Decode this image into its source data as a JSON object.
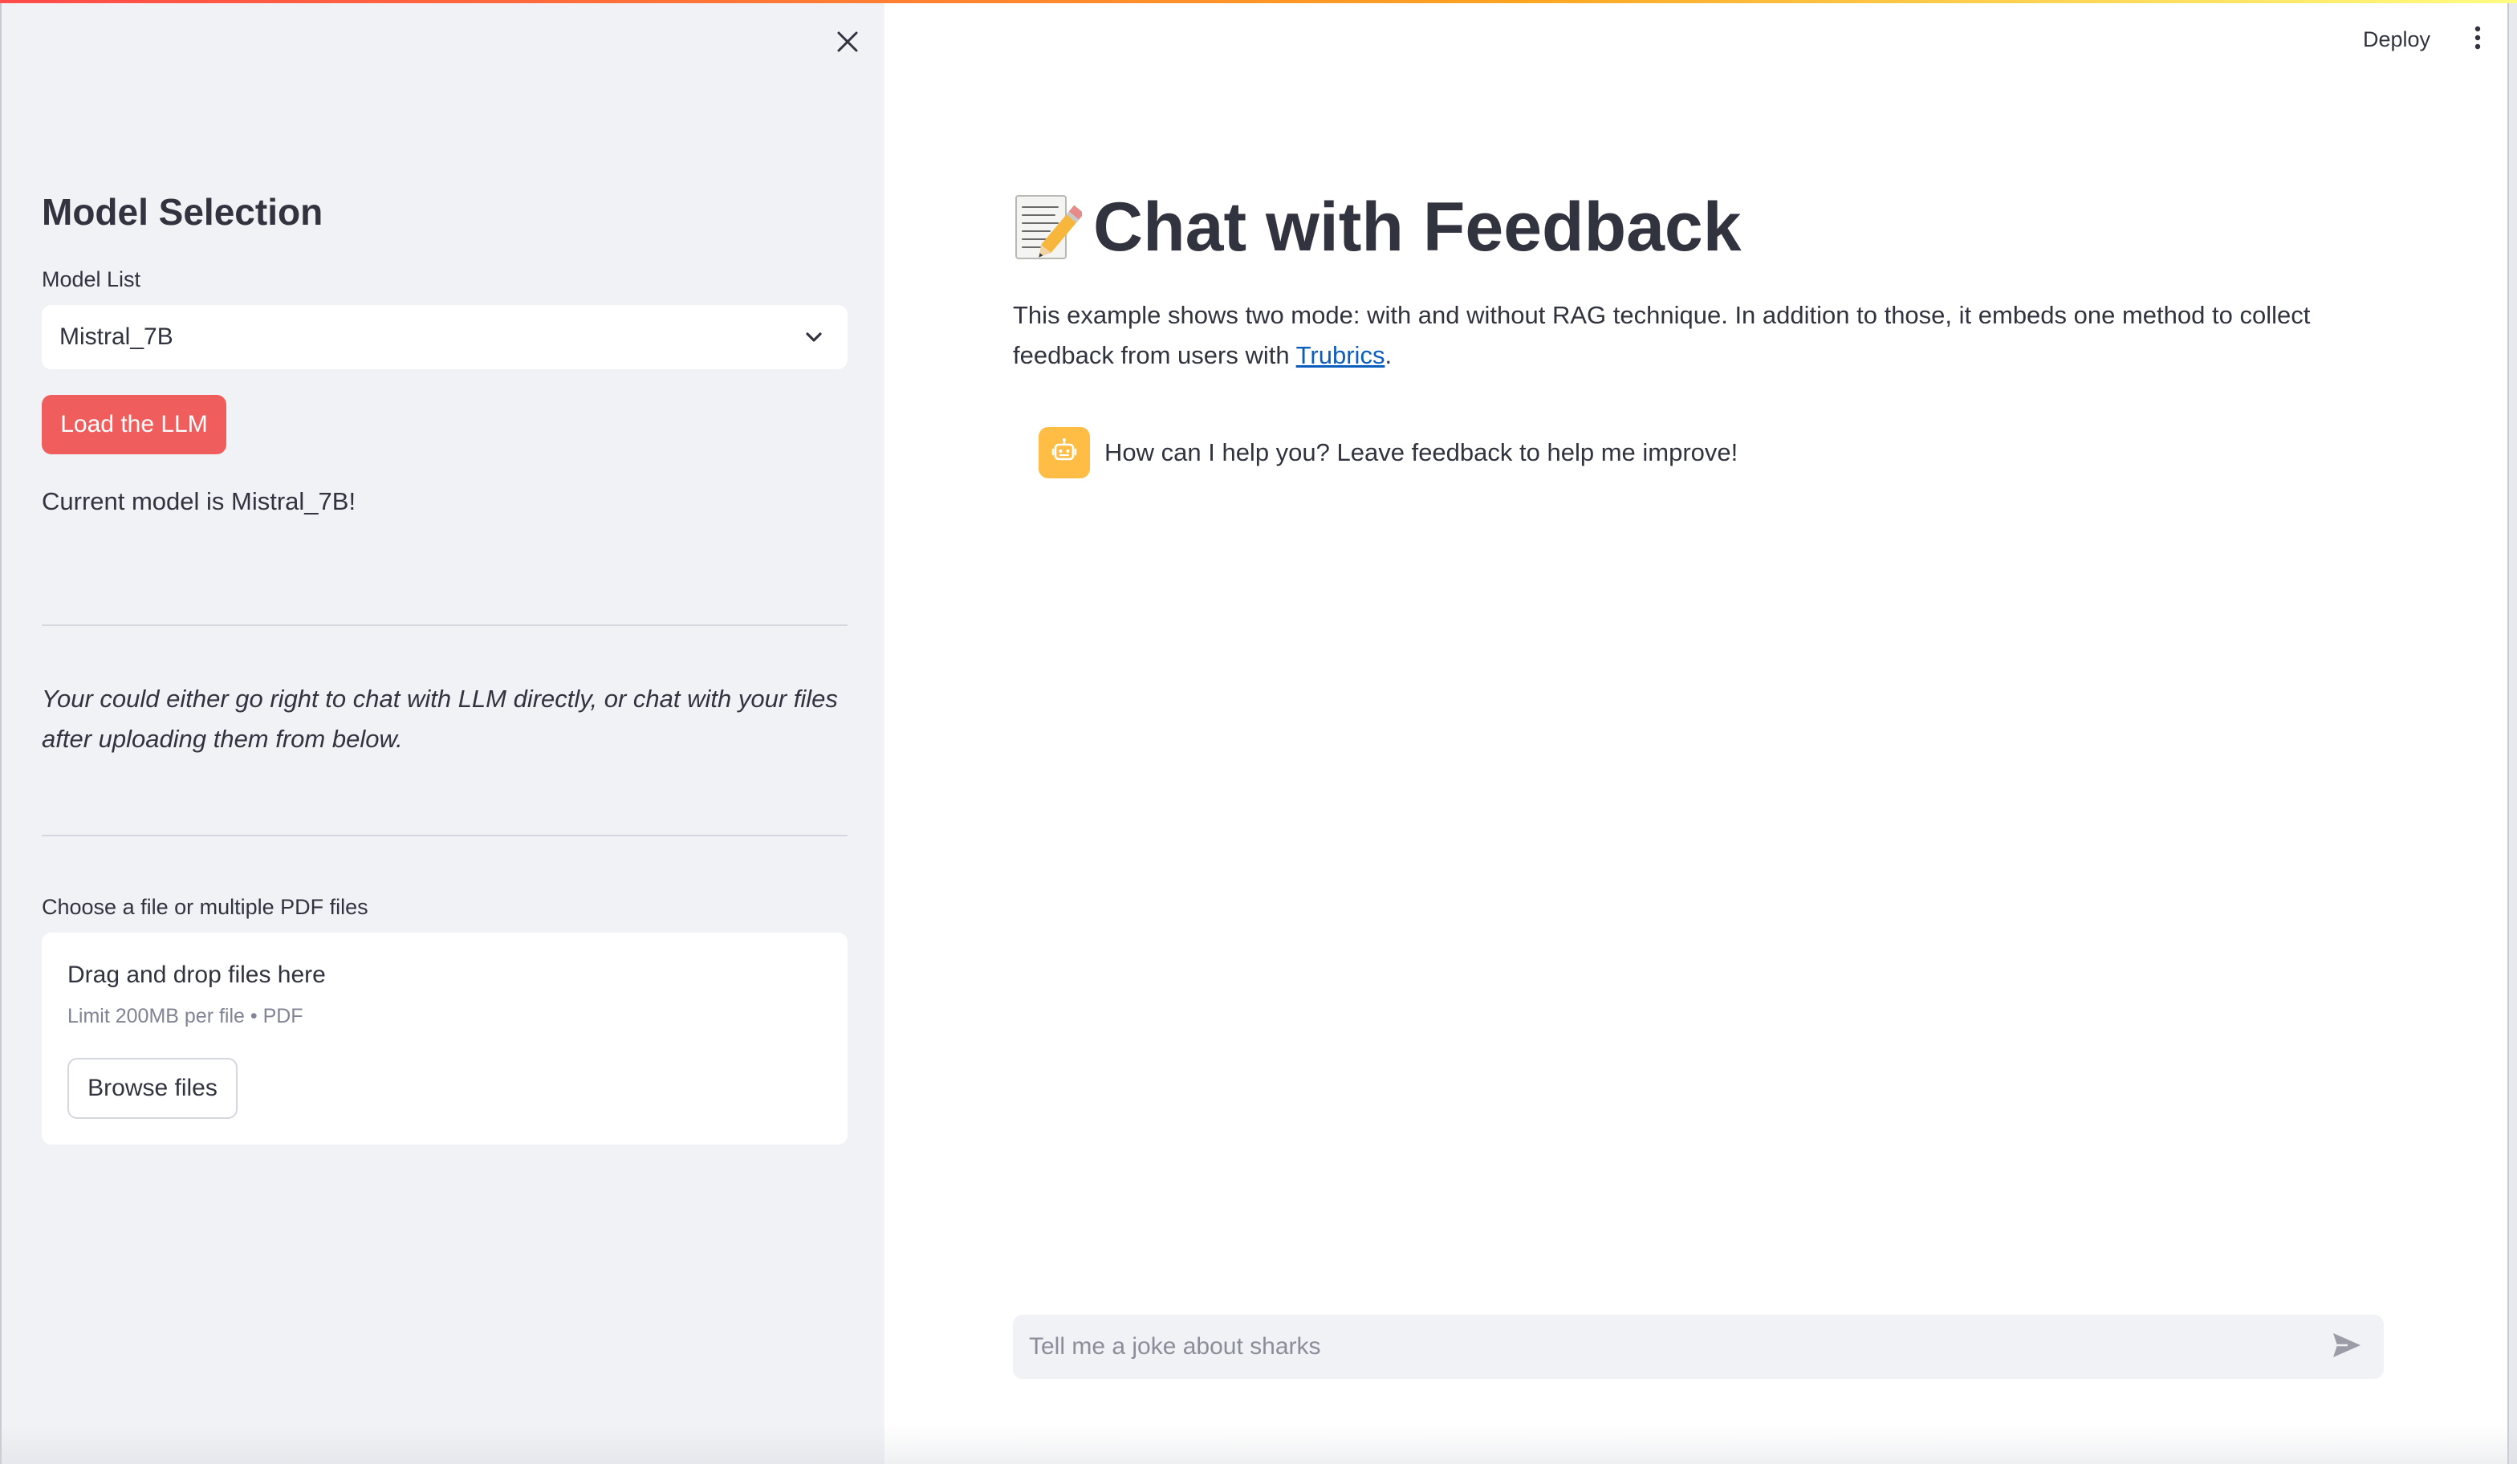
{
  "sidebar": {
    "title": "Model Selection",
    "model_list_label": "Model List",
    "model_select_value": "Mistral_7B",
    "load_button_label": "Load the LLM",
    "current_model_text": "Current model is Mistral_7B!",
    "note": "Your could either go right to chat with LLM directly, or chat with your files after uploading them from below.",
    "uploader": {
      "label": "Choose a file or multiple PDF files",
      "title": "Drag and drop files here",
      "limit": "Limit 200MB per file • PDF",
      "browse_label": "Browse files"
    },
    "icons": {
      "close": "close-icon",
      "dropdown": "chevron-down-icon"
    }
  },
  "header": {
    "deploy_label": "Deploy",
    "menu_icon": "more-vertical-icon"
  },
  "main": {
    "title_emoji_icon": "memo-pencil-icon",
    "title": "Chat with Feedback",
    "intro_text": "This example shows two mode: with and without RAG technique. In addition to those, it embeds one method to collect feedback from users with ",
    "intro_link": "Trubrics",
    "intro_suffix": ".",
    "messages": [
      {
        "role": "assistant",
        "avatar_icon": "bot-icon",
        "text": "How can I help you? Leave feedback to help me improve!"
      }
    ],
    "chat_input_placeholder": "Tell me a joke about sharks",
    "send_icon": "send-icon"
  },
  "colors": {
    "accent": "#ef5d5d",
    "sidebar_bg": "#f0f2f6",
    "text": "#31333F",
    "link": "#0b5ebd",
    "bot_avatar": "#ffbd45",
    "muted": "#808495"
  }
}
